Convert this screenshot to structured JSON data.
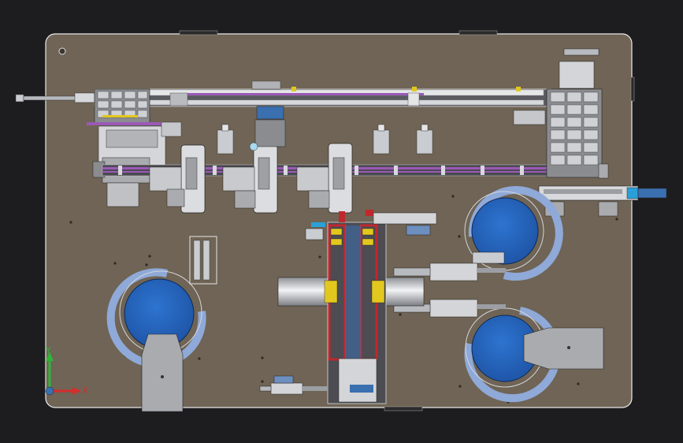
{
  "colors": {
    "background": "#1d1d1f",
    "base_plate": "#6f6455",
    "plate_edge": "#e8e8ea",
    "rail": "#d8d8dc",
    "guide_purple": "#9b59b6",
    "bowl_blue": "#2f6fc4",
    "bowl_rim": "#8fa9d8",
    "rotary_red": "#c0282d",
    "part_yellow": "#e2c81e",
    "steel": "#c9ccd1",
    "axis_x": "#d62d2d",
    "axis_y": "#2fb43a"
  },
  "icons": {
    "triad": "coordinate-axes-icon"
  },
  "axes": {
    "x_label": "X",
    "y_label": "Y"
  }
}
